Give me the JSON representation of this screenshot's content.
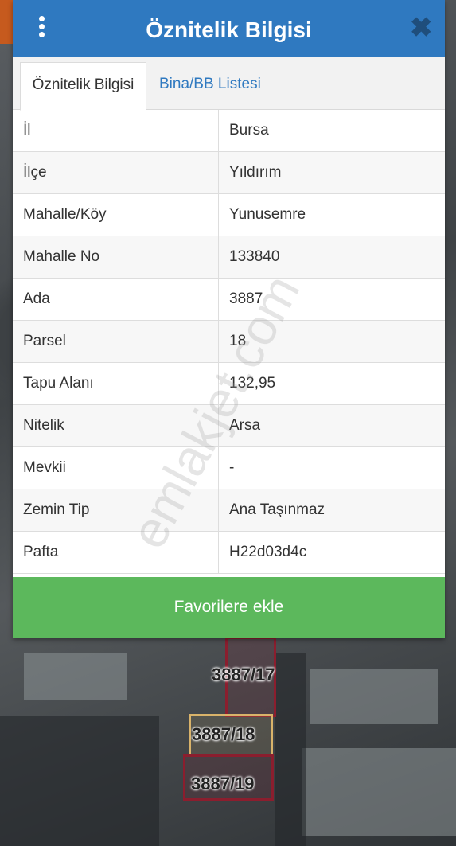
{
  "dialog": {
    "title": "Öznitelik Bilgisi",
    "close_symbol": "✖"
  },
  "tabs": [
    {
      "label": "Öznitelik Bilgisi",
      "active": true
    },
    {
      "label": "Bina/BB Listesi",
      "active": false
    }
  ],
  "attributes": [
    {
      "key": "İl",
      "value": "Bursa"
    },
    {
      "key": "İlçe",
      "value": "Yıldırım"
    },
    {
      "key": "Mahalle/Köy",
      "value": "Yunusemre"
    },
    {
      "key": "Mahalle No",
      "value": "133840"
    },
    {
      "key": "Ada",
      "value": "3887"
    },
    {
      "key": "Parsel",
      "value": "18"
    },
    {
      "key": "Tapu Alanı",
      "value": "132,95"
    },
    {
      "key": "Nitelik",
      "value": "Arsa"
    },
    {
      "key": "Mevkii",
      "value": "-"
    },
    {
      "key": "Zemin Tip",
      "value": "Ana Taşınmaz"
    },
    {
      "key": "Pafta",
      "value": "H22d03d4c"
    }
  ],
  "favorite_button": "Favorilere ekle",
  "watermark": "emlakjet.com",
  "map": {
    "parcels": [
      "3887/17",
      "3887/18",
      "3887/19"
    ]
  },
  "icons": {
    "menu": "kebab-menu-icon",
    "close": "close-icon"
  },
  "colors": {
    "header": "#2f79c0",
    "button": "#5cb85c",
    "parcel_outline": "#8b1e2e",
    "selected_parcel": "#d9b36a"
  }
}
